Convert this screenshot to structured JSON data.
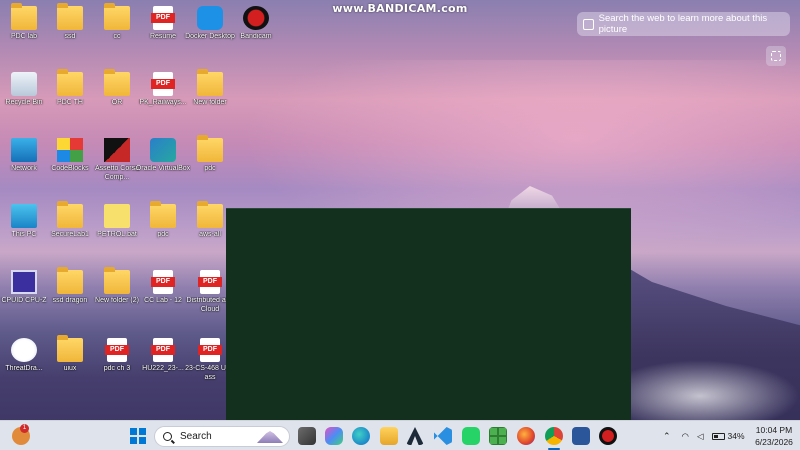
{
  "watermark": "www.BANDICAM.com",
  "search_bar": {
    "text": "Search the web to learn more about this picture"
  },
  "desktop_icons": [
    {
      "label": "PDC lab",
      "type": "folder"
    },
    {
      "label": "ssd",
      "type": "folder"
    },
    {
      "label": "cc",
      "type": "folder"
    },
    {
      "label": "Resume",
      "type": "pdf"
    },
    {
      "label": "Docker Desktop",
      "type": "app-docker"
    },
    {
      "label": "Bandicam",
      "type": "app-bandicam"
    },
    {
      "label": "Recycle Bin",
      "type": "recycle"
    },
    {
      "label": "PDC TH",
      "type": "folder"
    },
    {
      "label": "OR",
      "type": "folder"
    },
    {
      "label": "PK_Railways...",
      "type": "pdf"
    },
    {
      "label": "New folder",
      "type": "folder"
    },
    {
      "label": "Network",
      "type": "network"
    },
    {
      "label": "CodeBlocks",
      "type": "app-codeblocks"
    },
    {
      "label": "Assetto Corsa Comp...",
      "type": "app-assetto"
    },
    {
      "label": "Oracle VirtualBox",
      "type": "app-virtualbox"
    },
    {
      "label": "pdc",
      "type": "folder"
    },
    {
      "label": "This PC",
      "type": "pc"
    },
    {
      "label": "SecureLab1",
      "type": "folder"
    },
    {
      "label": "PETROL.bat",
      "type": "bat"
    },
    {
      "label": "pdc",
      "type": "folder"
    },
    {
      "label": "aws-all",
      "type": "folder"
    },
    {
      "label": "CPUID CPU-Z",
      "type": "app-cpuz"
    },
    {
      "label": "ssd dragon",
      "type": "folder"
    },
    {
      "label": "New folder (2)",
      "type": "folder"
    },
    {
      "label": "CC Lab - 12",
      "type": "pdf"
    },
    {
      "label": "Distributed and Cloud",
      "type": "pdf"
    },
    {
      "label": "ThreatDra...",
      "type": "app-threatdragon"
    },
    {
      "label": "uiux",
      "type": "folder"
    },
    {
      "label": "pdc ch 3",
      "type": "pdf"
    },
    {
      "label": "HU222_23-...",
      "type": "pdf"
    },
    {
      "label": "23-CS-468 Uiux ass",
      "type": "pdf"
    }
  ],
  "taskbar": {
    "search_placeholder": "Search",
    "battery_percent": "34%",
    "time": "10:04 PM",
    "date": "6/23/2026",
    "notification_count": "1",
    "colors": {
      "taskbar_bg": "#dfe3ec",
      "dark_window": "#13301f"
    }
  }
}
